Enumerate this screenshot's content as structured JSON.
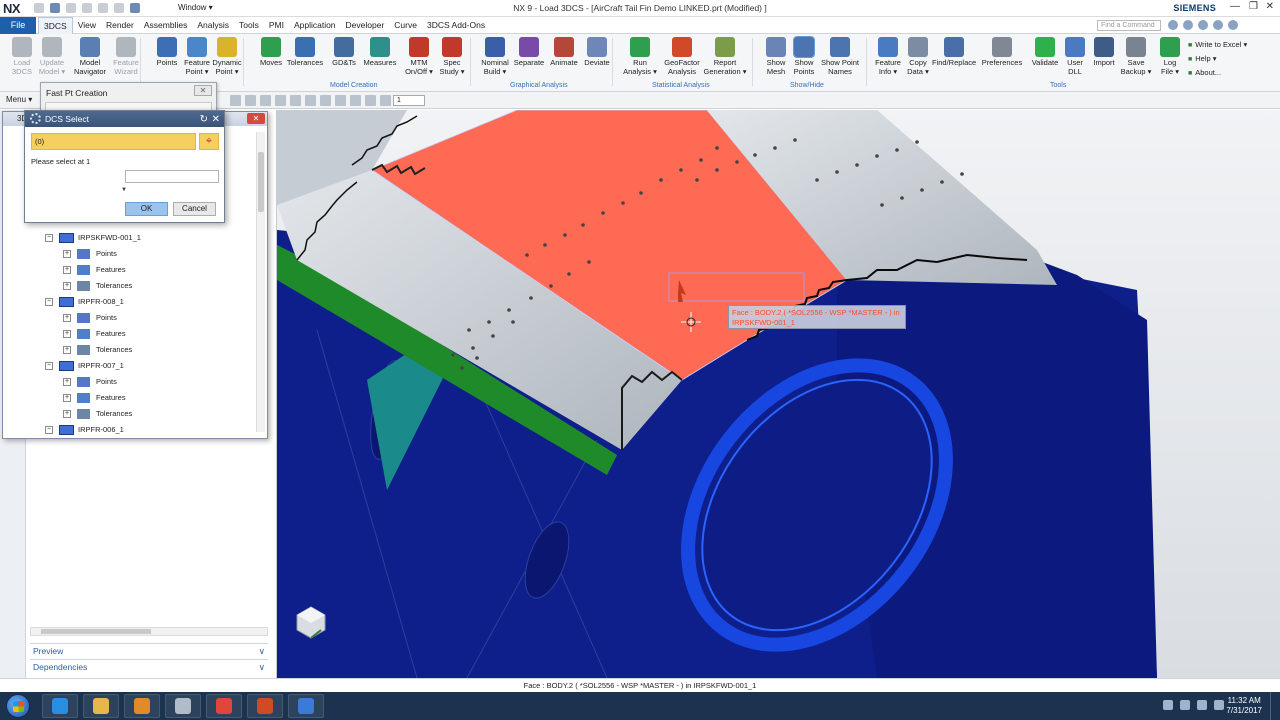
{
  "app": {
    "logo": "NX",
    "window_menu": "Window ▾",
    "title": "NX 9 - Load 3DCS - [AirCraft Tail Fin Demo LINKED.prt (Modified) ]",
    "brand": "SIEMENS"
  },
  "menubar": {
    "file": "File",
    "tabs": [
      "3DCS",
      "View",
      "Render",
      "Assemblies",
      "Analysis",
      "Tools",
      "PMI",
      "Application",
      "Developer",
      "Curve",
      "3DCS Add-Ons"
    ],
    "active_tab": "3DCS",
    "find_placeholder": "Find a Command"
  },
  "ribbon": {
    "buttons": [
      {
        "label": "Load\n3DCS",
        "icon": "load-icon",
        "color": "#b0b6bd",
        "disabled": true
      },
      {
        "label": "Update\nModel ▾",
        "icon": "update-icon",
        "color": "#b0b6bd",
        "disabled": true
      },
      {
        "label": "Model\nNavigator",
        "icon": "navigator-icon",
        "color": "#5b7fb3"
      },
      {
        "label": "Feature\nWizard",
        "icon": "wizard-icon",
        "color": "#b0b6bd",
        "disabled": true
      },
      {
        "label": "Points",
        "icon": "points-icon",
        "color": "#3e6fb6"
      },
      {
        "label": "Feature\nPoint ▾",
        "icon": "feature-point-icon",
        "color": "#4a86c9"
      },
      {
        "label": "Dynamic\nPoint ▾",
        "icon": "dynamic-point-icon",
        "color": "#d9b42a"
      },
      {
        "label": "Moves",
        "icon": "moves-icon",
        "color": "#2e9e4f"
      },
      {
        "label": "Tolerances",
        "icon": "tolerances-icon",
        "color": "#3a6fb0"
      },
      {
        "label": "GD&Ts",
        "icon": "gdt-icon",
        "color": "#456c9e"
      },
      {
        "label": "Measures",
        "icon": "measures-icon",
        "color": "#2f8f8a"
      },
      {
        "label": "MTM\nOn/Off ▾",
        "icon": "mtm-icon",
        "color": "#c0392b"
      },
      {
        "label": "Spec\nStudy ▾",
        "icon": "spec-study-icon",
        "color": "#c0392b"
      },
      {
        "label": "Nominal\nBuild ▾",
        "icon": "nominal-build-icon",
        "color": "#3b5ea8"
      },
      {
        "label": "Separate",
        "icon": "separate-icon",
        "color": "#7a4aa8"
      },
      {
        "label": "Animate",
        "icon": "animate-icon",
        "color": "#b5473a"
      },
      {
        "label": "Deviate",
        "icon": "deviate-icon",
        "color": "#6f86b8"
      },
      {
        "label": "Run\nAnalysis ▾",
        "icon": "run-analysis-icon",
        "color": "#2e9e4f"
      },
      {
        "label": "GeoFactor\nAnalysis",
        "icon": "geofactor-icon",
        "color": "#d04a2a"
      },
      {
        "label": "Report\nGeneration ▾",
        "icon": "report-icon",
        "color": "#7c9c4a"
      },
      {
        "label": "Show\nMesh",
        "icon": "show-mesh-icon",
        "color": "#6a84b5"
      },
      {
        "label": "Show\nPoints",
        "icon": "show-points-icon",
        "color": "#4b74b0",
        "active": true
      },
      {
        "label": "Show Point\nNames",
        "icon": "show-point-names-icon",
        "color": "#4b74b0"
      },
      {
        "label": "Feature\nInfo ▾",
        "icon": "feature-info-icon",
        "color": "#4a7bc2"
      },
      {
        "label": "Copy\nData ▾",
        "icon": "copy-data-icon",
        "color": "#7c8da3"
      },
      {
        "label": "Find/Replace",
        "icon": "find-replace-icon",
        "color": "#4a6fa8"
      },
      {
        "label": "Preferences",
        "icon": "preferences-icon",
        "color": "#7f8894"
      },
      {
        "label": "Validate",
        "icon": "validate-icon",
        "color": "#2eb04a"
      },
      {
        "label": "User\nDLL",
        "icon": "user-dll-icon",
        "color": "#4c7ac0"
      },
      {
        "label": "Import",
        "icon": "import-icon",
        "color": "#3e5c86"
      },
      {
        "label": "Save\nBackup ▾",
        "icon": "save-backup-icon",
        "color": "#7a8491"
      },
      {
        "label": "Log\nFile ▾",
        "icon": "log-file-icon",
        "color": "#2e9e4f"
      }
    ],
    "groups": [
      "Model Creation",
      "Graphical Analysis",
      "Statistical Analysis",
      "Show/Hide",
      "Tools"
    ],
    "excel_links": [
      "Write to Excel ▾",
      "Help ▾",
      "About..."
    ]
  },
  "toolbar2": {
    "menu": "Menu ▾",
    "select_value": "1"
  },
  "fast_pt": {
    "title": "Fast Pt Creation"
  },
  "navigator": {
    "title": "3D",
    "tree": [
      {
        "level": 0,
        "label": "IRPSKFWD-001_1",
        "type": "part"
      },
      {
        "level": 1,
        "label": "Points",
        "type": "points"
      },
      {
        "level": 1,
        "label": "Features",
        "type": "features"
      },
      {
        "level": 1,
        "label": "Tolerances",
        "type": "tolerances"
      },
      {
        "level": 0,
        "label": "IRPFR-008_1",
        "type": "part"
      },
      {
        "level": 1,
        "label": "Points",
        "type": "points"
      },
      {
        "level": 1,
        "label": "Features",
        "type": "features"
      },
      {
        "level": 1,
        "label": "Tolerances",
        "type": "tolerances"
      },
      {
        "level": 0,
        "label": "IRPFR-007_1",
        "type": "part"
      },
      {
        "level": 1,
        "label": "Points",
        "type": "points"
      },
      {
        "level": 1,
        "label": "Features",
        "type": "features"
      },
      {
        "level": 1,
        "label": "Tolerances",
        "type": "tolerances"
      },
      {
        "level": 0,
        "label": "IRPFR-006_1",
        "type": "part"
      }
    ],
    "footers": [
      "Preview",
      "Dependencies"
    ]
  },
  "dcs_select": {
    "title": "DCS Select",
    "selection_value": "(0)",
    "prompt": "Please select at 1",
    "ok": "OK",
    "cancel": "Cancel"
  },
  "viewport": {
    "tooltip_line1": "Face : BODY.2 ( *SOL2556 - WSP *MASTER - ) in",
    "tooltip_line2": "IRPSKFWD-001_1",
    "colors": {
      "body_blue": "#0e1f8c",
      "highlight_face": "#ff6a55",
      "skin_gray": "#c9cfd6",
      "accent_green": "#1f8a2a",
      "teal": "#1a8a8a"
    }
  },
  "status": {
    "text": "Face : BODY.2 ( *SOL2556 - WSP *MASTER - ) in IRPSKFWD-001_1"
  },
  "taskbar": {
    "time": "11:32 AM",
    "date": "7/31/2017",
    "apps": [
      {
        "name": "ie-icon",
        "color": "#2a8fe0"
      },
      {
        "name": "explorer-icon",
        "color": "#e6b84a"
      },
      {
        "name": "media-icon",
        "color": "#e08a2a"
      },
      {
        "name": "nx-icon",
        "color": "#b0bcc9"
      },
      {
        "name": "chrome-icon",
        "color": "#e0463a"
      },
      {
        "name": "powerpoint-icon",
        "color": "#d04a23"
      },
      {
        "name": "3dcs-icon",
        "color": "#3a7bd5"
      }
    ]
  }
}
